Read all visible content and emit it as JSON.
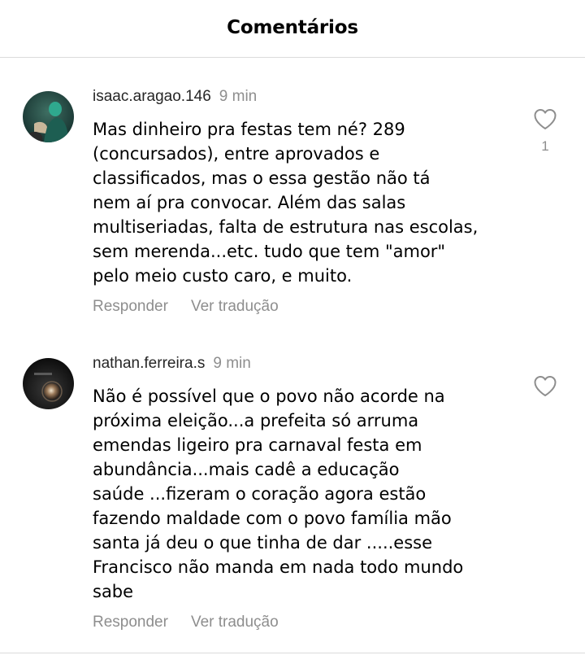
{
  "header": {
    "title": "Comentários"
  },
  "comments": [
    {
      "username": "isaac.aragao.146",
      "time": "9 min",
      "text": "Mas dinheiro pra festas tem né? 289\n(concursados), entre aprovados e\nclassificados, mas o essa gestão não tá\nnem aí pra convocar. Além das salas\nmultiseriadas, falta de estrutura nas escolas,\nsem merenda...etc. tudo que tem \"amor\"\npelo meio custo caro, e muito.",
      "reply_label": "Responder",
      "translate_label": "Ver tradução",
      "like_count": "1",
      "avatar_icon": "user-avatar"
    },
    {
      "username": "nathan.ferreira.s",
      "time": "9 min",
      "text": "Não é possível que o povo não acorde na\npróxima eleição...a prefeita só arruma\nemendas ligeiro pra carnaval festa em\nabundância...mais cadê a educação\nsaúde ...fizeram o coração agora estão\nfazendo maldade com o povo família mão\nsanta já deu o que tinha de dar .....esse\nFrancisco não manda em nada todo mundo\nsabe",
      "reply_label": "Responder",
      "translate_label": "Ver tradução",
      "avatar_icon": "user-avatar"
    }
  ],
  "colors": {
    "secondary_text": "#8e8e8e",
    "divider": "#dbdbdb",
    "primary_text": "#000000"
  }
}
